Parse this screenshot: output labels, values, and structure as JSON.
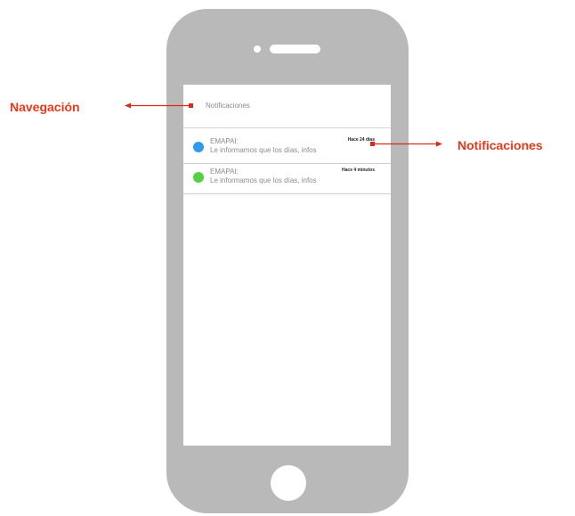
{
  "annotations": {
    "left_label": "Navegación",
    "right_label": "Notificaciones",
    "accent_color": "#e8381a"
  },
  "navbar": {
    "title": "Notificaciones"
  },
  "notifications": [
    {
      "sender": "EMAPAI:",
      "message": "Le informamos que los días, infos",
      "time": "Hace 24 días",
      "dot_color": "#2f9bf0"
    },
    {
      "sender": "EMAPAI:",
      "message": "Le informamos que los días, infos",
      "time": "Hace 4 minutos",
      "dot_color": "#55d042"
    }
  ]
}
